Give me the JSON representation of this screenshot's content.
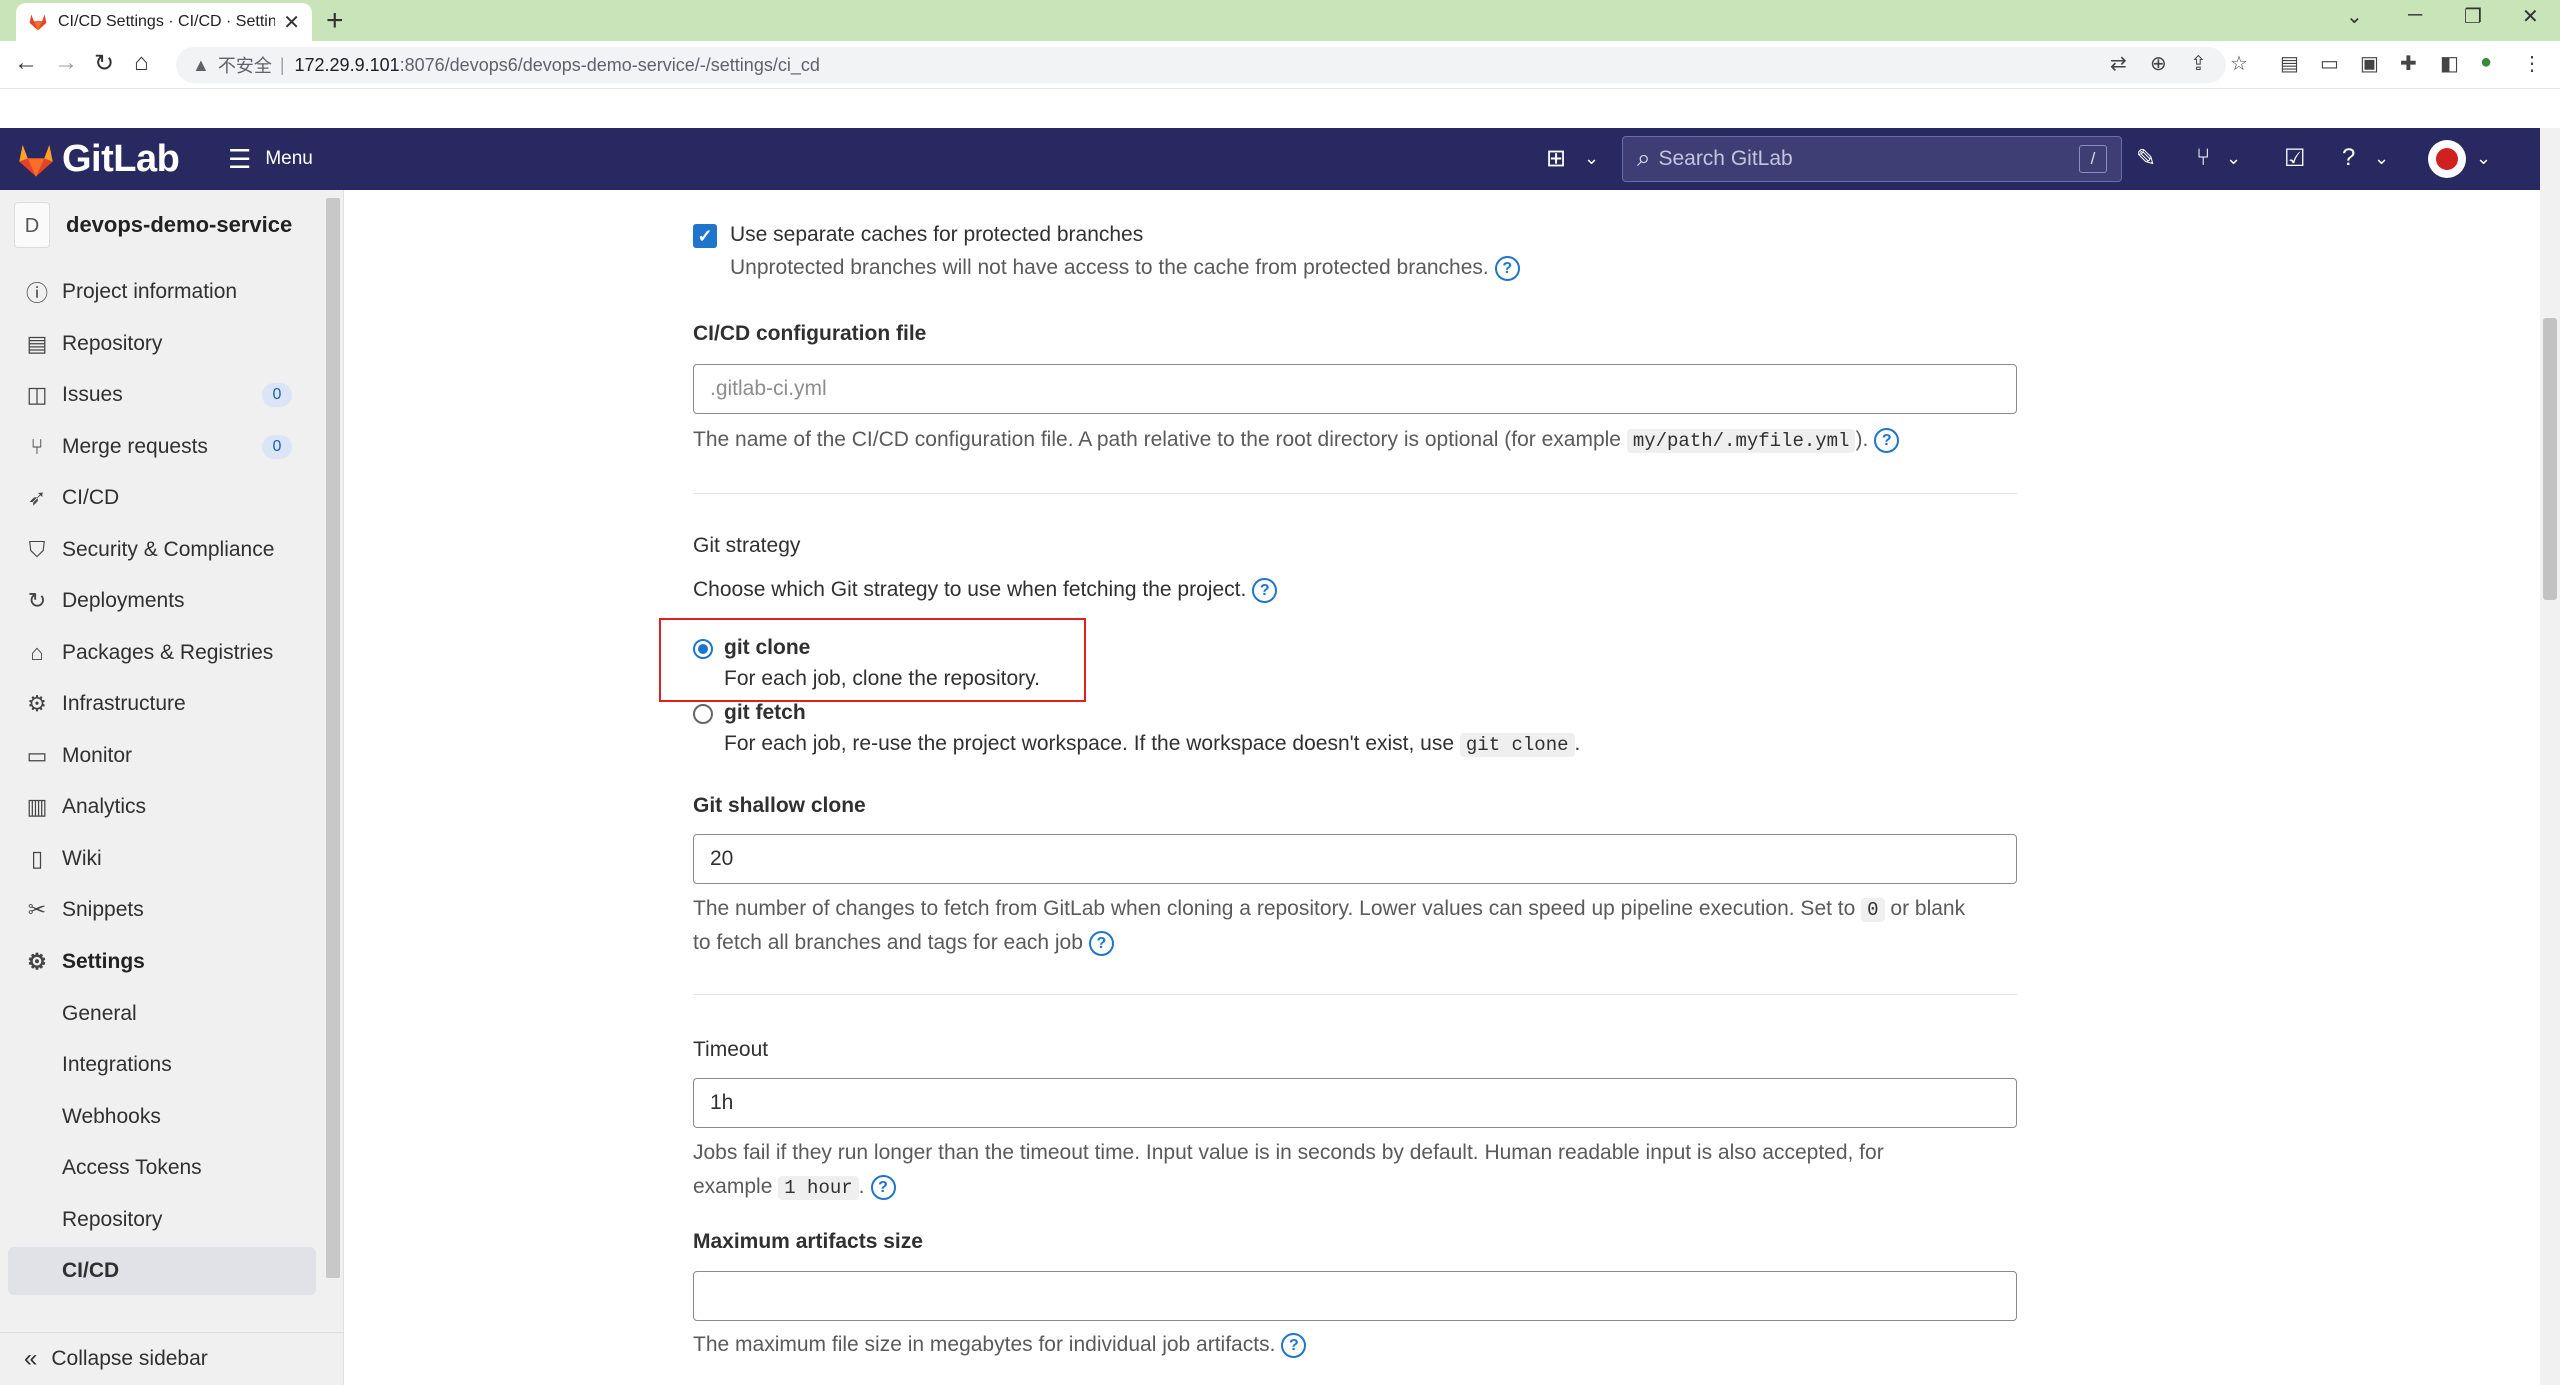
{
  "browser": {
    "tab_title": "CI/CD Settings · CI/CD · Settings",
    "tab_close": "✕",
    "new_tab": "+",
    "security_label": "不安全",
    "url_host": "172.29.9.101",
    "url_rest": ":8076/devops6/devops-demo-service/-/settings/ci_cd"
  },
  "header": {
    "brand": "GitLab",
    "menu_label": "Menu",
    "search_placeholder": "Search GitLab",
    "search_shortcut": "/"
  },
  "sidebar": {
    "project_avatar": "D",
    "project_name": "devops-demo-service",
    "items": [
      {
        "label": "Project information",
        "icon": "info-icon"
      },
      {
        "label": "Repository",
        "icon": "document-icon"
      },
      {
        "label": "Issues",
        "icon": "issues-icon",
        "count": "0"
      },
      {
        "label": "Merge requests",
        "icon": "merge-request-icon",
        "count": "0"
      },
      {
        "label": "CI/CD",
        "icon": "rocket-icon"
      },
      {
        "label": "Security & Compliance",
        "icon": "shield-icon"
      },
      {
        "label": "Deployments",
        "icon": "deployments-icon"
      },
      {
        "label": "Packages & Registries",
        "icon": "package-icon"
      },
      {
        "label": "Infrastructure",
        "icon": "cloud-gear-icon"
      },
      {
        "label": "Monitor",
        "icon": "monitor-icon"
      },
      {
        "label": "Analytics",
        "icon": "chart-icon"
      },
      {
        "label": "Wiki",
        "icon": "book-icon"
      },
      {
        "label": "Snippets",
        "icon": "scissors-icon"
      },
      {
        "label": "Settings",
        "icon": "gear-icon"
      }
    ],
    "settings_sub": [
      "General",
      "Integrations",
      "Webhooks",
      "Access Tokens",
      "Repository",
      "CI/CD"
    ],
    "collapse_label": "Collapse sidebar"
  },
  "main": {
    "separate_caches": {
      "label": "Use separate caches for protected branches",
      "help": "Unprotected branches will not have access to the cache from protected branches.",
      "checked": true
    },
    "config_file": {
      "label": "CI/CD configuration file",
      "placeholder": ".gitlab-ci.yml",
      "help_before": "The name of the CI/CD configuration file. A path relative to the root directory is optional (for example",
      "help_code": "my/path/.myfile.yml",
      "help_after": ")."
    },
    "git_strategy": {
      "label": "Git strategy",
      "help": "Choose which Git strategy to use when fetching the project.",
      "options": [
        {
          "label": "git clone",
          "help": "For each job, clone the repository.",
          "selected": true
        },
        {
          "label": "git fetch",
          "help_before": "For each job, re-use the project workspace. If the workspace doesn't exist, use",
          "help_code": "git clone",
          "help_after": ".",
          "selected": false
        }
      ]
    },
    "shallow_clone": {
      "label": "Git shallow clone",
      "value": "20",
      "help_before": "The number of changes to fetch from GitLab when cloning a repository. Lower values can speed up pipeline execution. Set to",
      "help_code": "0",
      "help_after": "or blank",
      "help_line2": "to fetch all branches and tags for each job"
    },
    "timeout": {
      "label": "Timeout",
      "value": "1h",
      "help_line1": "Jobs fail if they run longer than the timeout time. Input value is in seconds by default. Human readable input is also accepted, for",
      "help_before": "example",
      "help_code": "1 hour",
      "help_after": "."
    },
    "max_artifacts": {
      "label": "Maximum artifacts size",
      "value": "",
      "help": "The maximum file size in megabytes for individual job artifacts."
    }
  },
  "colors": {
    "header_bg": "#292961",
    "accent": "#1f75cb",
    "highlight_box": "#e02020",
    "tab_strip": "#c8e4b8"
  }
}
